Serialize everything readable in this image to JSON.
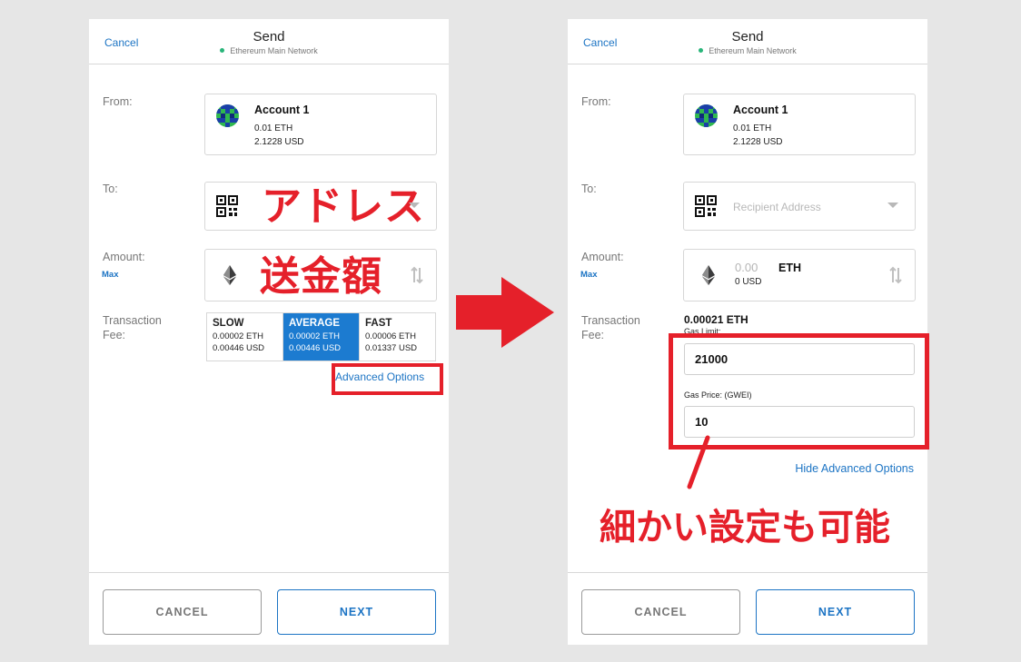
{
  "left": {
    "header": {
      "cancel": "Cancel",
      "title": "Send",
      "network": "Ethereum Main Network"
    },
    "labels": {
      "from": "From:",
      "to": "To:",
      "amount": "Amount:",
      "max": "Max",
      "fee_line1": "Transaction",
      "fee_line2": "Fee:"
    },
    "account": {
      "name": "Account 1",
      "eth": "0.01 ETH",
      "usd": "2.1228 USD"
    },
    "to_annotation": "アドレス",
    "amount_annotation": "送金額",
    "fees": [
      {
        "name": "SLOW",
        "eth": "0.00002 ETH",
        "usd": "0.00446 USD"
      },
      {
        "name": "AVERAGE",
        "eth": "0.00002 ETH",
        "usd": "0.00446 USD"
      },
      {
        "name": "FAST",
        "eth": "0.00006 ETH",
        "usd": "0.01337 USD"
      }
    ],
    "advanced": "Advanced Options",
    "buttons": {
      "cancel": "CANCEL",
      "next": "NEXT"
    }
  },
  "right": {
    "header": {
      "cancel": "Cancel",
      "title": "Send",
      "network": "Ethereum Main Network"
    },
    "labels": {
      "from": "From:",
      "to": "To:",
      "amount": "Amount:",
      "max": "Max",
      "fee_line1": "Transaction",
      "fee_line2": "Fee:"
    },
    "account": {
      "name": "Account 1",
      "eth": "0.01 ETH",
      "usd": "2.1228 USD"
    },
    "recipient_placeholder": "Recipient Address",
    "amount": {
      "value": "0.00",
      "usd": "0 USD",
      "unit": "ETH"
    },
    "fee_total": "0.00021 ETH",
    "gas_limit_label": "Gas Limit:",
    "gas_limit": "21000",
    "gas_price_label": "Gas Price: (GWEI)",
    "gas_price": "10",
    "hide_advanced": "Hide Advanced Options",
    "annotation": "細かい設定も可能",
    "buttons": {
      "cancel": "CANCEL",
      "next": "NEXT"
    }
  },
  "colors": {
    "accent": "#1c74c4",
    "annotation_red": "#e5202a",
    "network_dot": "#29b57a",
    "fee_selected": "#1c7bd0"
  },
  "icons": [
    "qr-code-icon",
    "ethereum-icon",
    "swap-icon",
    "dropdown-arrow-icon",
    "account-avatar-icon",
    "right-arrow-icon"
  ]
}
